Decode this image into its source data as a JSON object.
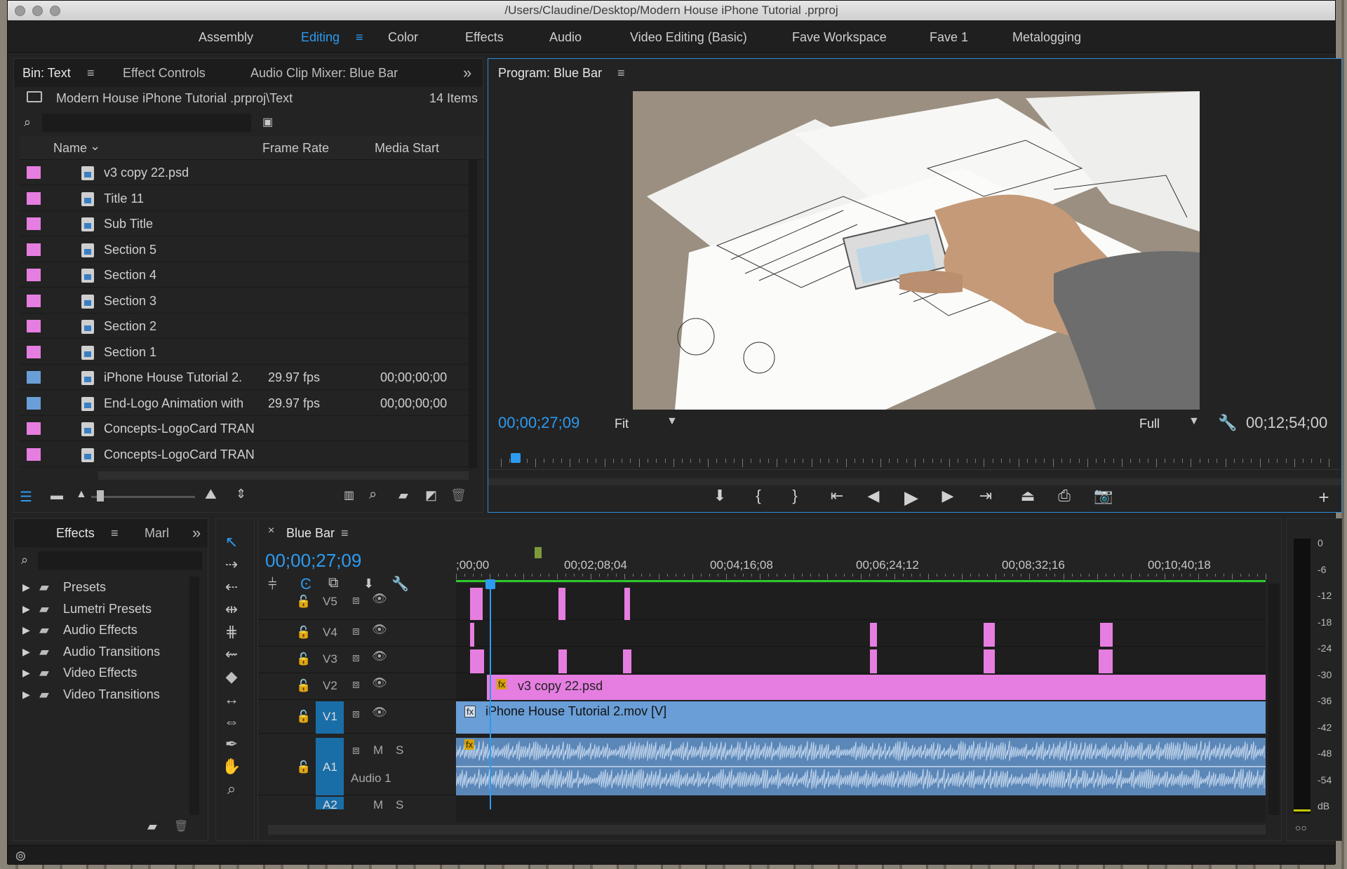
{
  "window": {
    "title": "/Users/Claudine/Desktop/Modern House iPhone Tutorial .prproj"
  },
  "workspaces": [
    {
      "label": "Assembly"
    },
    {
      "label": "Editing",
      "active": true
    },
    {
      "label": "Color"
    },
    {
      "label": "Effects"
    },
    {
      "label": "Audio"
    },
    {
      "label": "Video Editing (Basic)"
    },
    {
      "label": "Fave Workspace"
    },
    {
      "label": "Fave 1"
    },
    {
      "label": "Metalogging"
    }
  ],
  "project": {
    "tabs": [
      "Bin: Text",
      "Effect Controls",
      "Audio Clip Mixer: Blue Bar"
    ],
    "path": "Modern House iPhone Tutorial .prproj\\Text",
    "count": "14 Items",
    "columns": {
      "name": "Name",
      "frame_rate": "Frame Rate",
      "media_start": "Media Start"
    },
    "items": [
      {
        "name": "v3 copy 22.psd",
        "rate": "",
        "start": "",
        "color": "#e57ee0"
      },
      {
        "name": "Title 11",
        "rate": "",
        "start": "",
        "color": "#e57ee0"
      },
      {
        "name": "Sub Title",
        "rate": "",
        "start": "",
        "color": "#e57ee0"
      },
      {
        "name": "Section 5",
        "rate": "",
        "start": "",
        "color": "#e57ee0"
      },
      {
        "name": "Section 4",
        "rate": "",
        "start": "",
        "color": "#e57ee0"
      },
      {
        "name": "Section 3",
        "rate": "",
        "start": "",
        "color": "#e57ee0"
      },
      {
        "name": "Section 2",
        "rate": "",
        "start": "",
        "color": "#e57ee0"
      },
      {
        "name": "Section 1",
        "rate": "",
        "start": "",
        "color": "#e57ee0"
      },
      {
        "name": "iPhone House Tutorial 2.",
        "rate": "29.97 fps",
        "start": "00;00;00;00",
        "color": "#6a9ed6"
      },
      {
        "name": "End-Logo Animation with",
        "rate": "29.97 fps",
        "start": "00;00;00;00",
        "color": "#6a9ed6"
      },
      {
        "name": "Concepts-LogoCard TRAN",
        "rate": "",
        "start": "",
        "color": "#e57ee0"
      },
      {
        "name": "Concepts-LogoCard TRAN",
        "rate": "",
        "start": "",
        "color": "#e57ee0"
      }
    ]
  },
  "program": {
    "title": "Program: Blue Bar",
    "timecode": "00;00;27;09",
    "fit": "Fit",
    "quality": "Full",
    "duration": "00;12;54;00"
  },
  "effects": {
    "tabs": [
      "Effects",
      "Marl"
    ],
    "items": [
      "Presets",
      "Lumetri Presets",
      "Audio Effects",
      "Audio Transitions",
      "Video Effects",
      "Video Transitions"
    ]
  },
  "timeline": {
    "title": "Blue Bar",
    "timecode": "00;00;27;09",
    "ruler": [
      ";00;00",
      "00;02;08;04",
      "00;04;16;08",
      "00;06;24;12",
      "00;08;32;16",
      "00;10;40;18"
    ],
    "tracks": {
      "v5": "V5",
      "v4": "V4",
      "v3": "V3",
      "v2": "V2",
      "v1": "V1",
      "a1": "A1",
      "a1name": "Audio 1",
      "a2": "A2"
    },
    "clips": {
      "v2": "v3 copy 22.psd",
      "v1": "iPhone House Tutorial 2.mov [V]",
      "fx": "fx"
    },
    "m": "M",
    "s": "S"
  },
  "meter": {
    "labels": [
      "0",
      "-6",
      "-12",
      "-18",
      "-24",
      "-30",
      "-36",
      "-42",
      "-48",
      "-54",
      "dB"
    ]
  },
  "colors": {
    "accent": "#2d9bf0",
    "title_clip": "#e57ee0",
    "video_clip": "#6a9ed6",
    "green": "#2ec82e"
  }
}
